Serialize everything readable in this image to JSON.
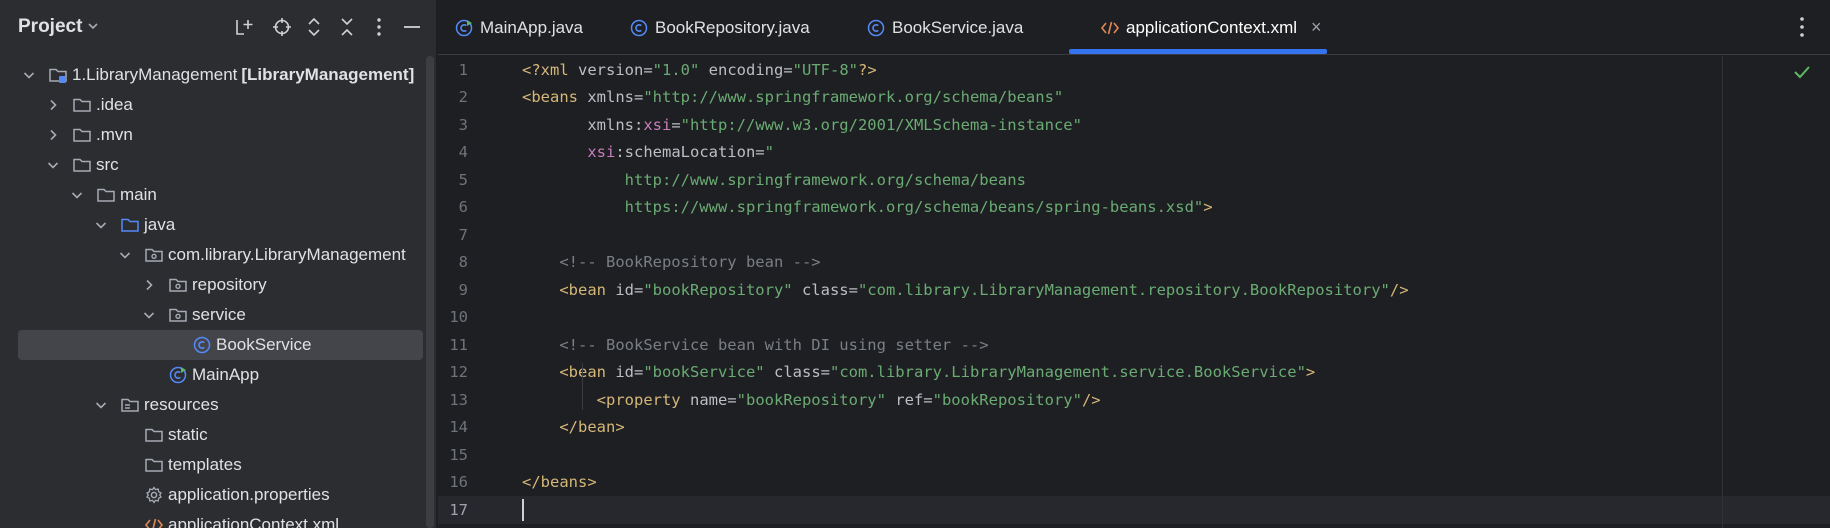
{
  "project": {
    "title": "Project",
    "tree": [
      {
        "depth": 0,
        "chevron": "down",
        "icon": "module-folder-icon",
        "label": "1.LibraryManagement",
        "bold": "[LibraryManagement]",
        "name": "tree-item-project-root"
      },
      {
        "depth": 1,
        "chevron": "right",
        "icon": "folder-icon",
        "label": ".idea",
        "name": "tree-item-idea"
      },
      {
        "depth": 1,
        "chevron": "right",
        "icon": "folder-icon",
        "label": ".mvn",
        "name": "tree-item-mvn"
      },
      {
        "depth": 1,
        "chevron": "down",
        "icon": "folder-icon",
        "label": "src",
        "name": "tree-item-src"
      },
      {
        "depth": 2,
        "chevron": "down",
        "icon": "folder-icon",
        "label": "main",
        "name": "tree-item-main"
      },
      {
        "depth": 3,
        "chevron": "down",
        "icon": "source-folder-icon",
        "label": "java",
        "name": "tree-item-java"
      },
      {
        "depth": 4,
        "chevron": "down",
        "icon": "package-icon",
        "label": "com.library.LibraryManagement",
        "name": "tree-item-package"
      },
      {
        "depth": 5,
        "chevron": "right",
        "icon": "package-icon",
        "label": "repository",
        "name": "tree-item-repository"
      },
      {
        "depth": 5,
        "chevron": "down",
        "icon": "package-icon",
        "label": "service",
        "name": "tree-item-service"
      },
      {
        "depth": 6,
        "chevron": "none",
        "icon": "class-icon",
        "label": "BookService",
        "name": "tree-item-bookservice",
        "selected": true
      },
      {
        "depth": 5,
        "chevron": "none",
        "icon": "main-class-icon",
        "label": "MainApp",
        "name": "tree-item-mainapp"
      },
      {
        "depth": 3,
        "chevron": "down",
        "icon": "resources-folder-icon",
        "label": "resources",
        "name": "tree-item-resources"
      },
      {
        "depth": 4,
        "chevron": "none",
        "icon": "folder-icon",
        "label": "static",
        "name": "tree-item-static"
      },
      {
        "depth": 4,
        "chevron": "none",
        "icon": "folder-icon",
        "label": "templates",
        "name": "tree-item-templates"
      },
      {
        "depth": 4,
        "chevron": "none",
        "icon": "gear-icon",
        "label": "application.properties",
        "name": "tree-item-application-properties"
      },
      {
        "depth": 4,
        "chevron": "none",
        "icon": "xml-icon",
        "label": "applicationContext.xml",
        "name": "tree-item-applicationcontext"
      }
    ]
  },
  "tabs": [
    {
      "label": "MainApp.java",
      "icon": "main-class-icon",
      "active": false
    },
    {
      "label": "BookRepository.java",
      "icon": "class-icon",
      "active": false
    },
    {
      "label": "BookService.java",
      "icon": "class-icon",
      "active": false
    },
    {
      "label": "applicationContext.xml",
      "icon": "xml-icon",
      "active": true
    }
  ],
  "tab_close_glyph": "×",
  "editor": {
    "current_line": 17,
    "lines": [
      [
        [
          "t-tag",
          "<?xml "
        ],
        [
          "t-attr",
          "version="
        ],
        [
          "t-val",
          "\"1.0\""
        ],
        [
          "t-attr",
          " encoding="
        ],
        [
          "t-val",
          "\"UTF-8\""
        ],
        [
          "t-tag",
          "?>"
        ]
      ],
      [
        [
          "t-tag",
          "<beans "
        ],
        [
          "t-attr",
          "xmlns="
        ],
        [
          "t-val",
          "\"http://www.springframework.org/schema/beans\""
        ]
      ],
      [
        [
          "t-plain",
          "       "
        ],
        [
          "t-attr",
          "xmlns:"
        ],
        [
          "t-ns",
          "xsi"
        ],
        [
          "t-attr",
          "="
        ],
        [
          "t-val",
          "\"http://www.w3.org/2001/XMLSchema-instance\""
        ]
      ],
      [
        [
          "t-plain",
          "       "
        ],
        [
          "t-ns",
          "xsi"
        ],
        [
          "t-attr",
          ":schemaLocation="
        ],
        [
          "t-val",
          "\""
        ]
      ],
      [
        [
          "t-plain",
          "           "
        ],
        [
          "t-val",
          "http://www.springframework.org/schema/beans"
        ]
      ],
      [
        [
          "t-plain",
          "           "
        ],
        [
          "t-val",
          "https://www.springframework.org/schema/beans/spring-beans.xsd\""
        ],
        [
          "t-tag",
          ">"
        ]
      ],
      [],
      [
        [
          "t-plain",
          "    "
        ],
        [
          "t-com",
          "<!-- BookRepository bean -->"
        ]
      ],
      [
        [
          "t-plain",
          "    "
        ],
        [
          "t-tag",
          "<bean "
        ],
        [
          "t-attr",
          "id="
        ],
        [
          "t-val",
          "\"bookRepository\""
        ],
        [
          "t-attr",
          " class="
        ],
        [
          "t-val",
          "\"com.library.LibraryManagement.repository.BookRepository\""
        ],
        [
          "t-tag",
          "/>"
        ]
      ],
      [],
      [
        [
          "t-plain",
          "    "
        ],
        [
          "t-com",
          "<!-- BookService bean with DI using setter -->"
        ]
      ],
      [
        [
          "t-plain",
          "    "
        ],
        [
          "t-tag",
          "<bean "
        ],
        [
          "t-attr",
          "id="
        ],
        [
          "t-val",
          "\"bookService\""
        ],
        [
          "t-attr",
          " class="
        ],
        [
          "t-val",
          "\"com.library.LibraryManagement.service.BookService\""
        ],
        [
          "t-tag",
          ">"
        ]
      ],
      [
        [
          "t-plain",
          "        "
        ],
        [
          "t-tag",
          "<property "
        ],
        [
          "t-attr",
          "name="
        ],
        [
          "t-val",
          "\"bookRepository\""
        ],
        [
          "t-attr",
          " ref="
        ],
        [
          "t-val",
          "\"bookRepository\""
        ],
        [
          "t-tag",
          "/>"
        ]
      ],
      [
        [
          "t-plain",
          "    "
        ],
        [
          "t-tag",
          "</bean>"
        ]
      ],
      [],
      [
        [
          "t-tag",
          "</beans>"
        ]
      ],
      []
    ]
  },
  "colors": {
    "accent": "#3574f0",
    "folder": "#a6aab3",
    "class_blue": "#548af7",
    "xml_orange": "#e08855",
    "check_green": "#5fb865"
  }
}
